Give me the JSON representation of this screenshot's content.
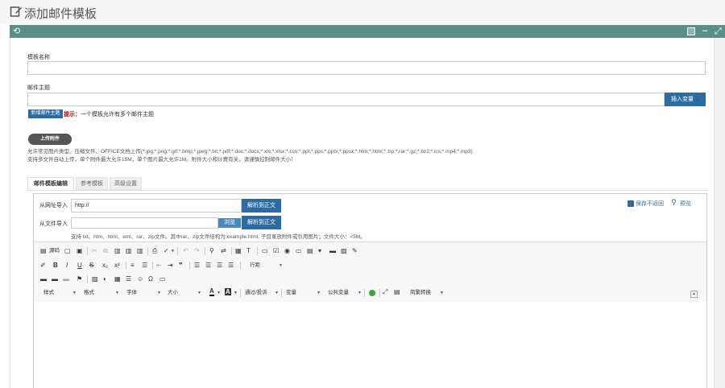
{
  "page": {
    "title": "添加邮件模板"
  },
  "form": {
    "name_label": "模板名称",
    "subject_label": "邮件主题",
    "insert_var_label": "插入变量",
    "add_subject_label": "新增邮件主题",
    "tip_prefix": "提示：",
    "tip_text": "一个模板允许有多个邮件主题",
    "upload_label": "上传附件",
    "attach_note_1": "允许常见图片类型、压缩文件、OFFICE文档上传(*.jpg;*.png;*.gif;*.bmp;*.jpeg;*.txt;*.pdf;*.doc;*.docx;*.xls;*.xlsx;*.csv;*.ppt;*.pps;*.pptx;*.ppsx;*.htm;*.html;*.zip;*.rar;*.gz;*.bz2;*.ics;*.mp4;*.mp3)",
    "attach_note_2": "支持多文件自动上传，单个附件最大允许15M，单个图片最大允许1M。附件大小和计费有关，请谨慎控制邮件大小！"
  },
  "tabs": [
    {
      "label": "邮件模板编辑",
      "active": true
    },
    {
      "label": "参考模板",
      "active": false
    },
    {
      "label": "高级设置",
      "active": false
    }
  ],
  "import": {
    "url_label": "从网址导入",
    "url_value": "http://",
    "parse_btn": "解析到正文",
    "file_label": "从文件导入",
    "browse_btn": "浏览",
    "file_note": "支持 txt、htm、html、eml、rar、zip文件。其中rar、zip文件结构为:example.html, 子目录放附件或引用图片；文件大小：<5M。",
    "save_label": "保存不返回",
    "preview_label": "预览"
  },
  "toolbar": {
    "source_label": "源码",
    "paragraph_label": "行距",
    "style_label": "样式",
    "format_label": "格式",
    "font_label": "字体",
    "size_label": "大小",
    "unit_label": "通过/投诉",
    "var_label": "变量",
    "public_var_label": "公共变量",
    "convert_label": "简繁转换"
  },
  "colors": {
    "accent": "#2d6ca2",
    "window_bar": "#5a8f88",
    "tip_red": "#c00000"
  }
}
